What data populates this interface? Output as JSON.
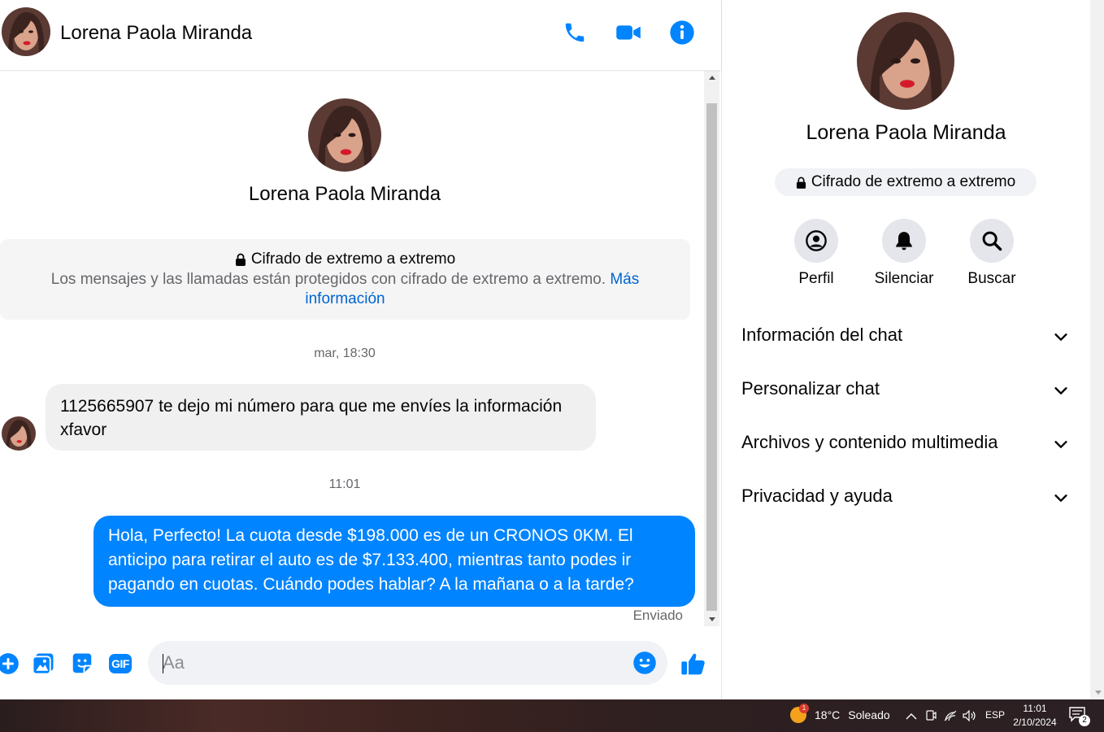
{
  "header": {
    "contact_name": "Lorena Paola Miranda",
    "icons": [
      "phone-icon",
      "video-camera-icon",
      "info-icon"
    ]
  },
  "intro": {
    "contact_name": "Lorena Paola Miranda",
    "e2ee_title": "Cifrado de extremo a extremo",
    "e2ee_description": "Los mensajes y las llamadas están protegidos con cifrado de extremo a extremo.",
    "e2ee_link": "Más información"
  },
  "messages": [
    {
      "type": "timestamp",
      "text": "mar, 18:30"
    },
    {
      "type": "incoming",
      "text": "1125665907 te dejo mi número para que me envíes la información xfavor"
    },
    {
      "type": "timestamp",
      "text": "11:01"
    },
    {
      "type": "outgoing",
      "text": "Hola, Perfecto! La cuota desde $198.000 es de un CRONOS 0KM. El anticipo para retirar el auto es de $7.133.400, mientras tanto podes ir pagando en cuotas. Cuándo podes hablar? A la mañana o a la tarde?",
      "status": "Enviado"
    }
  ],
  "composer": {
    "placeholder": "Aa",
    "gif_label": "GIF",
    "icons": [
      "plus-icon",
      "image-icon",
      "sticker-icon",
      "gif-icon",
      "emoji-icon",
      "thumbs-up-icon"
    ]
  },
  "info_panel": {
    "contact_name": "Lorena Paola Miranda",
    "e2ee_badge": "Cifrado de extremo a extremo",
    "actions": [
      {
        "label": "Perfil",
        "icon": "profile-icon"
      },
      {
        "label": "Silenciar",
        "icon": "bell-icon"
      },
      {
        "label": "Buscar",
        "icon": "search-icon"
      }
    ],
    "sections": [
      {
        "label": "Información del chat"
      },
      {
        "label": "Personalizar chat"
      },
      {
        "label": "Archivos y contenido multimedia"
      },
      {
        "label": "Privacidad y ayuda"
      }
    ]
  },
  "taskbar": {
    "weather_temp": "18°C",
    "weather_desc": "Soleado",
    "weather_badge": "1",
    "language": "ESP",
    "time": "11:01",
    "date": "2/10/2024",
    "notification_count": "2"
  },
  "colors": {
    "accent": "#0084ff",
    "link": "#0064d1",
    "incoming_bubble": "#f0f0f0",
    "secondary_text": "#65676b"
  }
}
